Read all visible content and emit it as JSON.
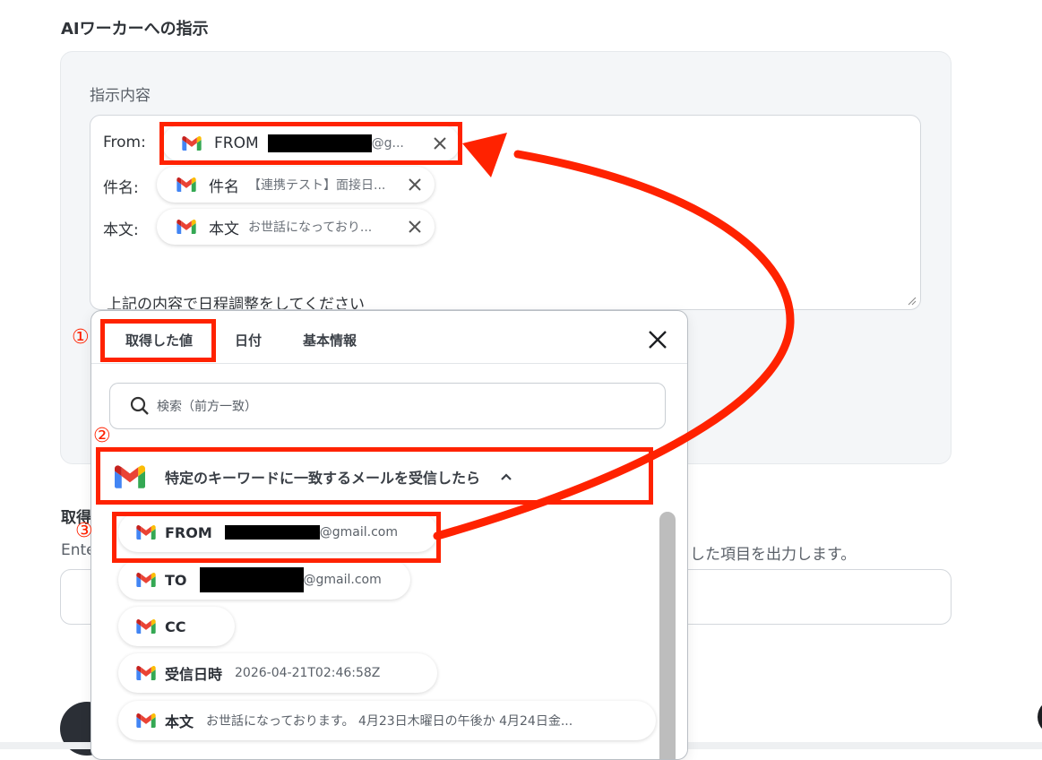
{
  "section_title": "AIワーカーへの指示",
  "panel": {
    "label": "指示内容",
    "rows": [
      {
        "label": "From:",
        "chip_name": "FROM",
        "chip_value": "@g..."
      },
      {
        "label": "件名:",
        "chip_name": "件名",
        "chip_value": "【連携テスト】面接日..."
      },
      {
        "label": "本文:",
        "chip_name": "本文",
        "chip_value": "お世話になっており..."
      }
    ],
    "text_line": "上記の内容で日程調整をしてください"
  },
  "background": {
    "label1": "取得",
    "label2": "Ente",
    "label3": "した項目を出力します。"
  },
  "popup": {
    "tabs": [
      "取得した値",
      "日付",
      "基本情報"
    ],
    "search_placeholder": "検索（前方一致）",
    "group_title": "特定のキーワードに一致するメールを受信したら",
    "items": [
      {
        "name": "FROM",
        "value": "@gmail.com"
      },
      {
        "name": "TO",
        "value": "@gmail.com"
      },
      {
        "name": "CC",
        "value": ""
      },
      {
        "name": "受信日時",
        "value": "2026-04-21T02:46:58Z"
      },
      {
        "name": "本文",
        "value": "お世話になっております。 4月23日木曜日の午後か 4月24日金..."
      }
    ]
  },
  "annotations": [
    "①",
    "②",
    "③"
  ],
  "colors": {
    "annotation_red": "#ff2200",
    "gmail_red": "#EA4335",
    "gmail_blue": "#4285F4",
    "gmail_green": "#34A853",
    "gmail_yellow": "#FBBC05"
  }
}
